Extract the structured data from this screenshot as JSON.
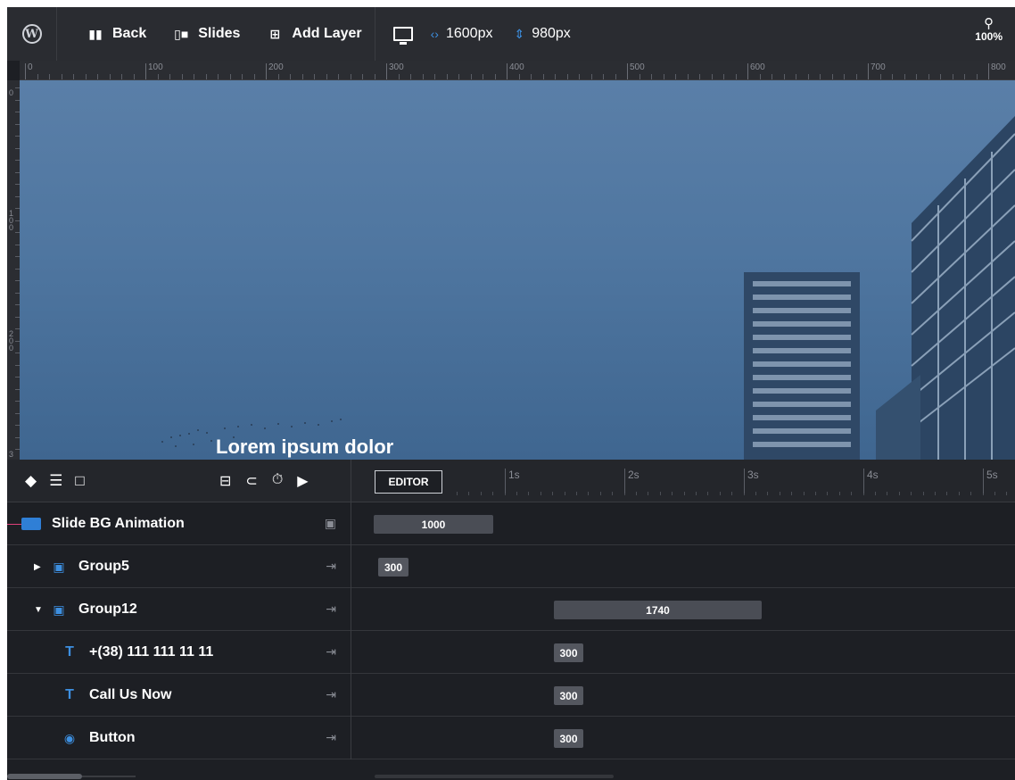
{
  "toolbar": {
    "back_label": "Back",
    "slides_label": "Slides",
    "add_layer_label": "Add Layer",
    "width_value": "1600px",
    "height_value": "980px",
    "zoom_value": "100%"
  },
  "ruler": {
    "horizontal_labels": [
      "0",
      "100",
      "200",
      "300",
      "400",
      "500",
      "600",
      "700",
      "800"
    ],
    "vertical_labels": [
      "0",
      "100",
      "200",
      "3"
    ]
  },
  "canvas": {
    "text": "Lorem ipsum dolor"
  },
  "timeline": {
    "editor_tab": "EDITOR",
    "seconds": [
      "1s",
      "2s",
      "3s",
      "4s",
      "5s"
    ],
    "rows": [
      {
        "label": "Slide BG Animation",
        "value": "1000"
      },
      {
        "label": "Group5",
        "value": "300"
      },
      {
        "label": "Group12",
        "value": "1740"
      },
      {
        "label": "+(38) 111 111 11 11",
        "value": "300"
      },
      {
        "label": "Call Us Now",
        "value": "300"
      },
      {
        "label": "Button",
        "value": "300"
      }
    ]
  },
  "colors": {
    "accent": "#3d8fe0",
    "background": "#1d1f24",
    "toolbar": "#2a2c31"
  }
}
